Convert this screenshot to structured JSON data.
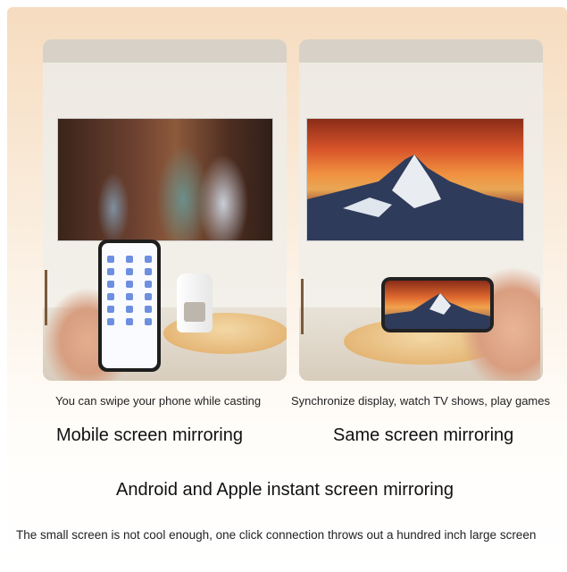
{
  "panels": {
    "left": {
      "caption": "You can swipe your phone while casting",
      "heading": "Mobile screen mirroring"
    },
    "right": {
      "caption": "Synchronize display, watch TV shows, play games",
      "heading": "Same screen mirroring"
    }
  },
  "subtitle": "Android and Apple instant screen mirroring",
  "footer": "The small screen is not cool enough, one click connection throws out a hundred inch large screen",
  "colors": {
    "background_top": "#f6dcbf",
    "background_bottom": "#ffffff"
  }
}
